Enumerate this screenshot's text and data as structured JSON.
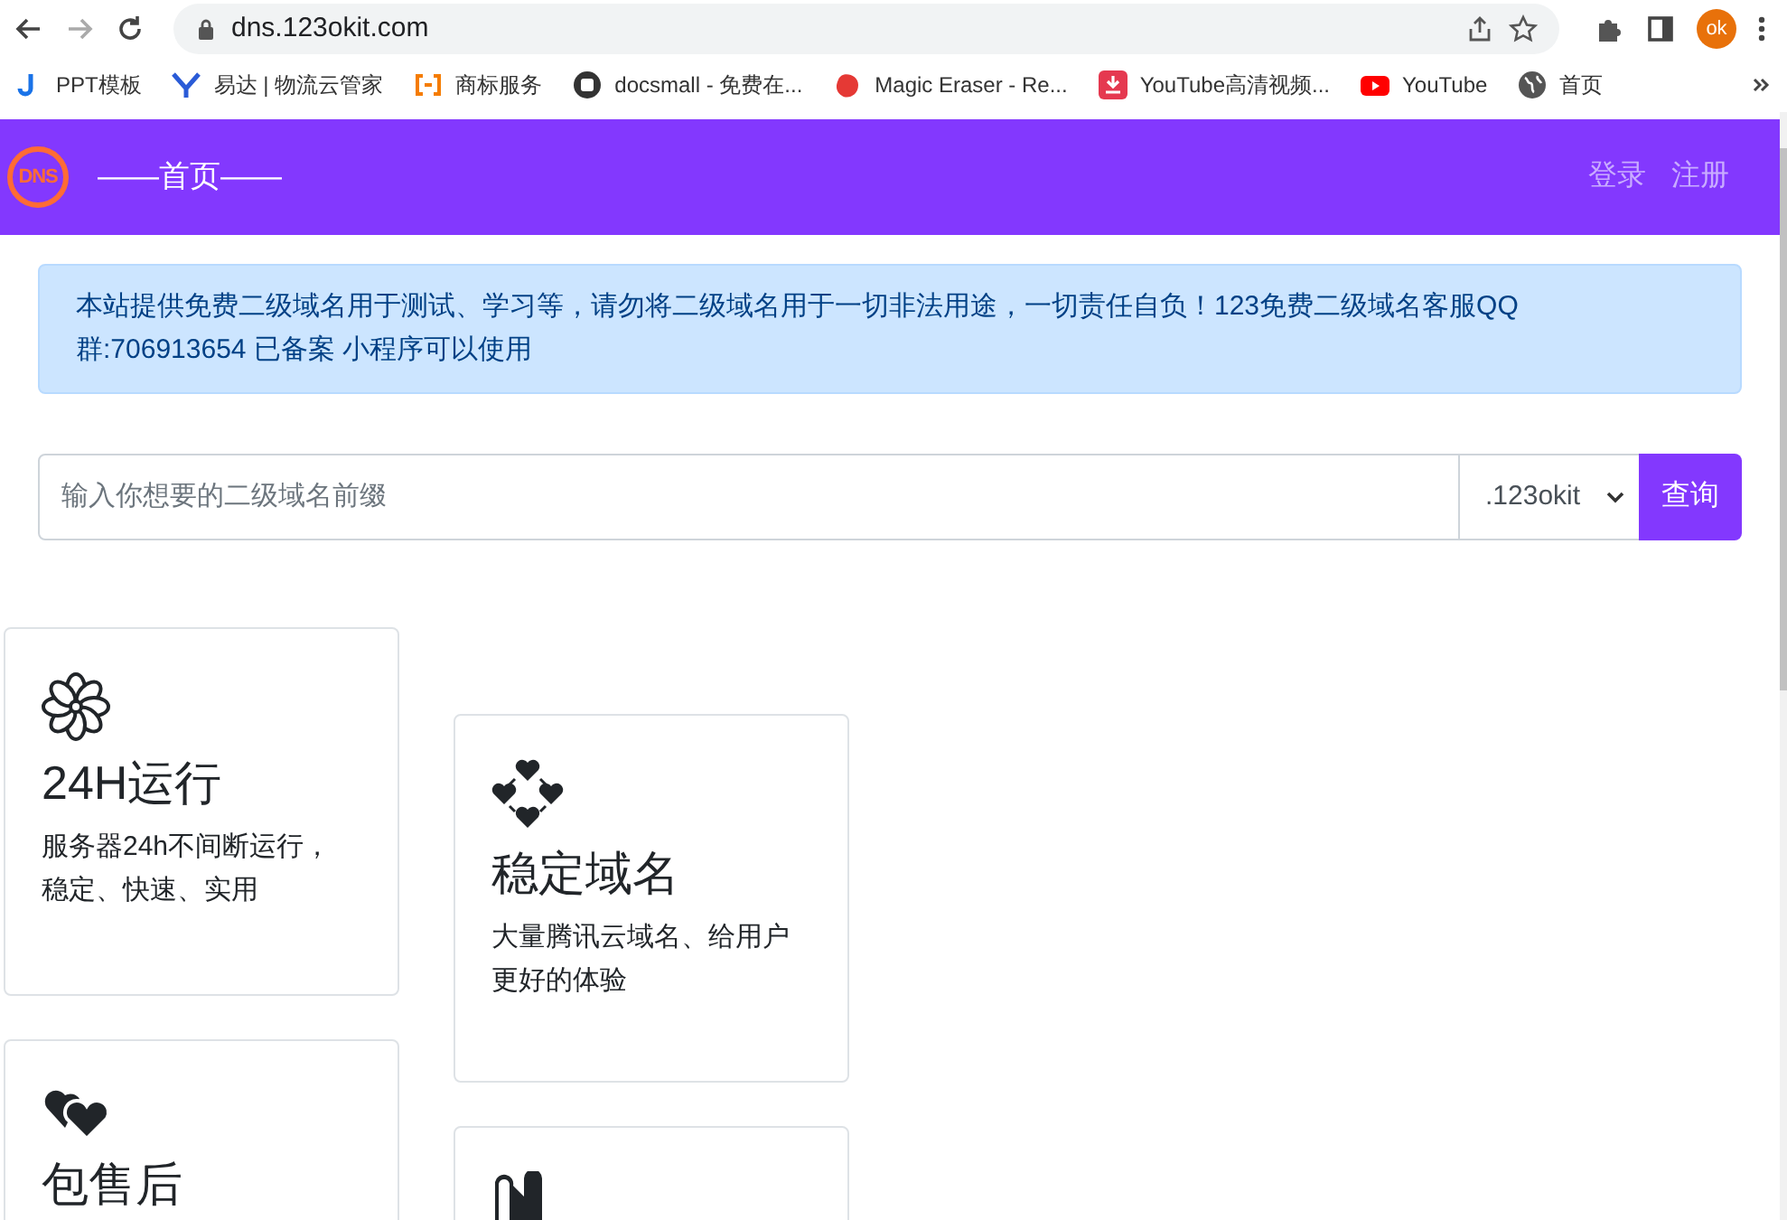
{
  "browser": {
    "url": "dns.123okit.com",
    "profile": "ok",
    "bookmarks": [
      {
        "label": "PPT模板"
      },
      {
        "label": "易达 | 物流云管家"
      },
      {
        "label": "商标服务"
      },
      {
        "label": "docsmall - 免费在..."
      },
      {
        "label": "Magic Eraser - Re..."
      },
      {
        "label": "YouTube高清视频..."
      },
      {
        "label": "YouTube"
      },
      {
        "label": "首页"
      }
    ]
  },
  "navbar": {
    "logo": "DNS",
    "home": "——首页——",
    "links": [
      "登录",
      "注册"
    ]
  },
  "notice": "本站提供免费二级域名用于测试、学习等，请勿将二级域名用于一切非法用途，一切责任自负！123免费二级域名客服QQ群:706913654 已备案 小程序可以使用",
  "search": {
    "placeholder": "输入你想要的二级域名前缀",
    "suffix": ".123okit",
    "button": "查询"
  },
  "features": [
    {
      "title": "24H运行",
      "text": "服务器24h不间断运行，稳定、快速、实用"
    },
    {
      "title": "稳定域名",
      "text": "大量腾讯云域名、给用户更好的体验"
    },
    {
      "title": "包售后"
    }
  ]
}
